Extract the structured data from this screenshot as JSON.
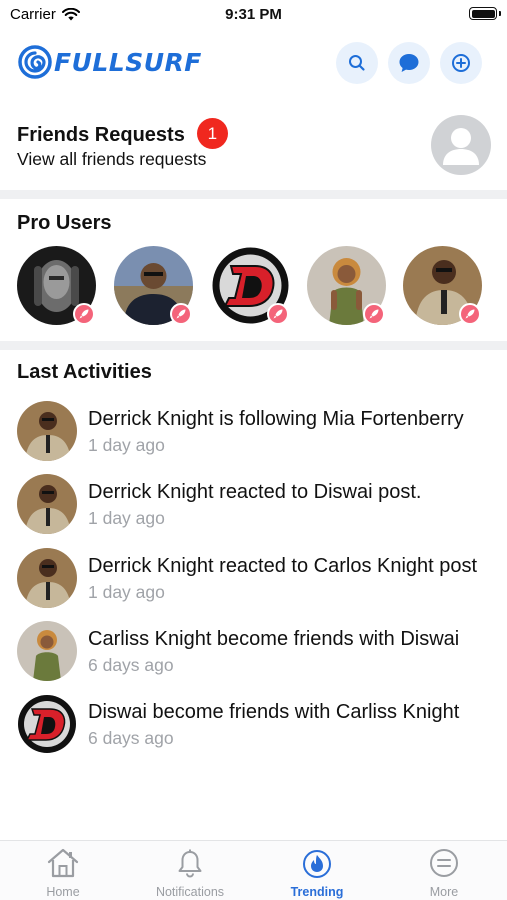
{
  "status_bar": {
    "carrier": "Carrier",
    "time": "9:31 PM"
  },
  "header": {
    "logo_text": "FULLSURF",
    "icons": [
      "search-icon",
      "chat-bubble-icon",
      "add-circle-icon"
    ],
    "accent_color": "#1e6ed8"
  },
  "friend_requests": {
    "title": "Friends Requests",
    "count": "1",
    "subtitle": "View all friends requests"
  },
  "pro_users": {
    "title": "Pro Users",
    "users": [
      {
        "avatar": "face-hands-bw"
      },
      {
        "avatar": "man-stadium"
      },
      {
        "avatar": "red-d-logo"
      },
      {
        "avatar": "woman-green-top"
      },
      {
        "avatar": "man-tan-jacket"
      }
    ],
    "badge_icon": "rocket-icon",
    "badge_color": "#f4647a"
  },
  "last_activities": {
    "title": "Last Activities",
    "items": [
      {
        "text": "Derrick Knight is following Mia Fortenberry",
        "time": "1 day ago"
      },
      {
        "text": "Derrick Knight reacted to Diswai post.",
        "time": "1 day ago"
      },
      {
        "text": "Derrick Knight reacted to Carlos Knight post",
        "time": "1 day ago"
      },
      {
        "text": "Carliss Knight become friends with Diswai",
        "time": "6 days ago"
      },
      {
        "text": "Diswai become friends with Carliss Knight",
        "time": "6 days ago"
      }
    ]
  },
  "tab_bar": {
    "tabs": [
      {
        "label": "Home",
        "icon": "home-icon"
      },
      {
        "label": "Notifications",
        "icon": "bell-icon"
      },
      {
        "label": "Trending",
        "icon": "flame-icon"
      },
      {
        "label": "More",
        "icon": "menu-circle-icon"
      }
    ],
    "active": "Trending",
    "active_color": "#2a6ed8"
  }
}
